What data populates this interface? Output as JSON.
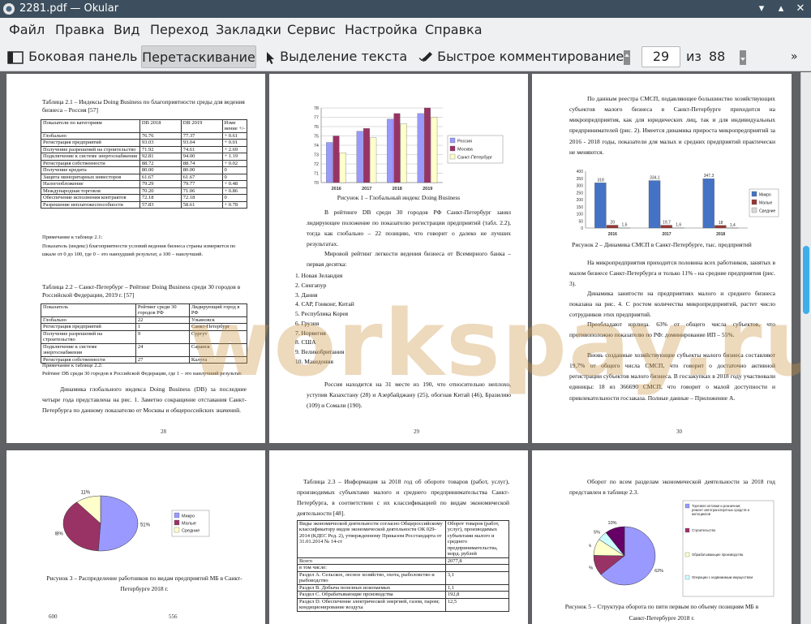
{
  "window": {
    "title": "2281.pdf  — Okular"
  },
  "menu": [
    "Файл",
    "Правка",
    "Вид",
    "Переход",
    "Закладки",
    "Сервис",
    "Настройка",
    "Справка"
  ],
  "toolbar": {
    "sidebar": "Боковая панель",
    "drag": "Перетаскивание",
    "select_text": "Выделение текста",
    "annotate": "Быстрое комментирование",
    "page_current": "29",
    "of_label": "из",
    "page_total": "88"
  },
  "watermark": "workspay.ru",
  "p28": {
    "t1_caption": "Таблица 2.1 – Индексы Doing Business по благоприятности среды для ведения бизнеса – Россия [57]",
    "t1_header": [
      "Показатели по категориям",
      "DB 2018",
      "DB 2019",
      "Изме нение +/-"
    ],
    "t1_rows": [
      [
        "Глобально",
        "76.76",
        "77.37",
        "+ 0.61"
      ],
      [
        "Регистрация предприятий",
        "93.03",
        "93.04",
        "+ 0.01"
      ],
      [
        "Получение разрешений на строительство",
        "71.92",
        "74.61",
        "+ 2.69"
      ],
      [
        "Подключение к системе энергоснабжения",
        "92.81",
        "94.00",
        "+ 1.19"
      ],
      [
        "Регистрация собственности",
        "88.72",
        "88.74",
        "+ 0.02"
      ],
      [
        "Получение кредита",
        "80.00",
        "80.00",
        "0"
      ],
      [
        "Защита миноритарных инвесторов",
        "61.67",
        "61.67",
        "0"
      ],
      [
        "Налогообложение",
        "79.29",
        "79.77",
        "+ 0.48"
      ],
      [
        "Международная торговля",
        "70.20",
        "71.06",
        "+ 0.86"
      ],
      [
        "Обеспечение исполнения контрактов",
        "72.18",
        "72.18",
        "0"
      ],
      [
        "Разрешение неплатежеспособности",
        "57.83",
        "58.61",
        "+ 0.78"
      ]
    ],
    "t1_note1": "Примечание к таблице 2.1:",
    "t1_note2": "Показатель (индекс) благоприятности условий ведения бизнеса страны измеряется по шкале от 0 до 100, где 0 – это наихудший результат, а 100 – наилучший.",
    "t2_caption": "Таблица 2.2 – Санкт-Петербург – Рейтинг Doing Business среди 30 городов в Российской Федерации, 2019 г. [57]",
    "t2_header": [
      "Показатель",
      "Рейтинг среди 30 городов РФ",
      "Лидирующий город в РФ"
    ],
    "t2_rows": [
      [
        "Глобально",
        "22",
        "Ульяновск"
      ],
      [
        "Регистрация предприятий",
        "1",
        "Санкт-Петербург"
      ],
      [
        "Получение разрешений на строительство",
        "9",
        "Сургут"
      ],
      [
        "Подключение к системе энергоснабжения",
        "24",
        "Саранск"
      ],
      [
        "Регистрация собственности",
        "27",
        "Калуга"
      ]
    ],
    "t2_note1": "Примечание к таблице 2.2:",
    "t2_note2": "Рейтинг DB среди 30 городов в Российской Федерации, где 1 – это наилучший результат.",
    "para": "Динамика глобального индекса Doing Business (DB) за последние четыре года представлена на рис. 1. Заметно сокращение отставания Санкт-Петербурга по данному показателю от Москвы и общероссийских значений.",
    "num": "28"
  },
  "p29": {
    "fig_caption": "Рисунок 1 – Глобальный индекс Doing Business",
    "para1": "В рейтинге DB среди 30 городов РФ Санкт-Петербург занял лидирующее положение по показателю регистрации предприятий (табл. 2.2), тогда как глобально – 22 позицию, что говорит о далеко не лучших результатах.",
    "para2": "Мировой рейтинг легкости ведения бизнеса от Всемирного банка – первая десятка:",
    "top10": [
      "1.  Новая Зеландия",
      "2.  Сингапур",
      "3.  Дания",
      "4.  САР, Гонконг, Китай",
      "5.  Республика Корея",
      "6.  Грузия",
      "7.  Норвегия",
      "8.  США",
      "9.  Великобритания",
      "10. Македония"
    ],
    "para3": "Россия находится на 31 месте из 190, что относительно неплохо, уступив Казахстану (28) и Азербайджану (25), обогнав Китай (46), Бразилию (109) и Сомали (190).",
    "num": "29"
  },
  "p30": {
    "para1": "По данным реестра СМСП, подавляющее большинство хозяйствующих субъектов малого бизнеса в Санкт-Петербурге приходится на микропредприятия, как для юридических лиц, так и для индивидуальных предпринимателей (рис. 2). Имеется динамика прироста микропредприятий за 2016 - 2018 годы, показатели для малых и средних предприятий практически не меняются.",
    "fig_caption": "Рисунок 2 – Динамика СМСП в Санкт-Петербурге, тыс. предприятий",
    "para2": "На микропредприятия приходится половина всех работников, занятых в малом бизнесе Санкт-Петербурга и только 11% - на средние предприятия (рис. 3).",
    "para3": "Динамика занятости на предприятиях малого и среднего бизнеса показана на рис. 4. С ростом количества микропредприятий, растет число сотрудников этих предприятий.",
    "para4": "Преобладают юрлица. 63% от общего числа субъектов, что противоположно показателю по РФ: доминирование ИП – 55%.",
    "para5": "Вновь созданные хозяйствующие субъекты малого бизнеса составляют 19,7% от общего числа СМСП, что говорит о достаточно активной регистрации субъектов малого бизнеса. В госзакупках в 2018 году участвовали единицы: 18 из 366690 СМСП, что говорит о малой доступности и привлекательности госзаказа. Полные данные – Приложение А.",
    "num": "30"
  },
  "p31": {
    "fig_caption": "Рисунок 3 – Распределение работников по видам предприятий МБ в Санкт-Петербурге 2018 г.",
    "bottom_left": "600",
    "bottom_right": "556"
  },
  "p32": {
    "para": "Таблица 2.3 – Информация за 2018 год об обороте товаров (работ, услуг), производимых субъектами малого и среднего предпринимательства Санкт-Петербурга, в соответствии с их классификацией по видам экономической деятельности [48].",
    "head_left": "Виды экономической деятельности согласно Общероссийскому классификатору видов экономической деятельности ОК 029-2014 (КДЕС Ред. 2), утвержденному Приказом Росстандарта от 31.01.2014 № 14-ст",
    "head_right": "Оборот товаров (работ, услуг), производимых субъектами малого и среднего предпринимательства, млрд. рублей",
    "rows": [
      [
        "Всего",
        "2077,8"
      ],
      [
        "в том числе:",
        ""
      ],
      [
        "Раздел А. Сельское, лесное хозяйство, охота, рыболовство и рыбоводство",
        "3,1"
      ],
      [
        "Раздел B. Добыча полезных ископаемых",
        "1,1"
      ],
      [
        "Раздел C. Обрабатывающие производства",
        "192,8"
      ],
      [
        "Раздел D. Обеспечение электрической энергией, газом, паром; кондиционирование воздуха",
        "12,5"
      ]
    ]
  },
  "p33": {
    "para": "Оборот по всем разделам экономической деятельности за 2018 год представлен в таблице 2.3.",
    "legend": [
      "Торговля оптовая и розничная; ремонт автотранспортных средств и мотоциклов",
      "Строительство",
      "Обрабатывающие производства",
      "Операции с недвижимым имуществом"
    ],
    "fig_caption": "Рисунок 5 – Структура оборота по пяти первым по объему позициям МБ в",
    "fig_caption2": "Санкт-Петербурге 2018 г."
  },
  "chart_data": [
    {
      "type": "bar",
      "title": "",
      "categories": [
        "2016",
        "2017",
        "2018",
        "2019"
      ],
      "series": [
        {
          "name": "Россия",
          "values": [
            74.3,
            75.5,
            76.8,
            77.4
          ]
        },
        {
          "name": "Москва",
          "values": [
            75,
            75.8,
            77.4,
            78
          ]
        },
        {
          "name": "Санкт-Петербург",
          "values": [
            73.2,
            74.8,
            76.3,
            77
          ]
        }
      ],
      "ylim": [
        70,
        78
      ],
      "yticks": [
        70,
        71,
        72,
        73,
        74,
        75,
        76,
        77,
        78
      ],
      "colors": [
        "#9999ff",
        "#993366",
        "#ffffcc"
      ],
      "legend": "right",
      "grid": true
    },
    {
      "type": "bar",
      "title": "",
      "categories": [
        "2016",
        "2017",
        "2018"
      ],
      "series": [
        {
          "name": "Микро",
          "values": [
            318,
            334.1,
            347.3
          ],
          "labels": [
            "318",
            "334,1",
            "347,3"
          ]
        },
        {
          "name": "Малые",
          "values": [
            20,
            19.7,
            18
          ],
          "labels": [
            "20",
            "19,7",
            "18"
          ]
        },
        {
          "name": "Средние",
          "values": [
            1.6,
            1.6,
            1.4
          ],
          "labels": [
            "1,6",
            "1,6",
            "1,4"
          ]
        }
      ],
      "ylim": [
        0,
        400
      ],
      "yticks": [
        0,
        50,
        100,
        150,
        200,
        250,
        300,
        350,
        400
      ],
      "colors": [
        "#4472c4",
        "#953735",
        "#d9d9d9"
      ],
      "legend": "right",
      "grid": false
    },
    {
      "type": "pie",
      "title": "",
      "labels": [
        "Микро",
        "Малые",
        "Средние"
      ],
      "values": [
        51,
        38,
        11
      ],
      "value_labels": [
        "51%",
        "38%",
        "11%"
      ],
      "colors": [
        "#9999ff",
        "#993366",
        "#ffffcc"
      ],
      "legend": "right"
    },
    {
      "type": "pie",
      "title": "",
      "labels": [
        "Торговля оптовая и розничная; ремонт автотранспортных средств и мотоциклов",
        "Строительство",
        "Обрабатывающие производства",
        "Операции с недвижимым имуществом",
        ""
      ],
      "values": [
        62,
        11,
        9,
        5,
        10
      ],
      "value_labels": [
        "62%",
        "11%",
        "9%",
        "5%",
        "10%"
      ],
      "colors": [
        "#9999ff",
        "#993366",
        "#ffffcc",
        "#ccffff",
        "#660066"
      ],
      "legend": "right"
    }
  ]
}
